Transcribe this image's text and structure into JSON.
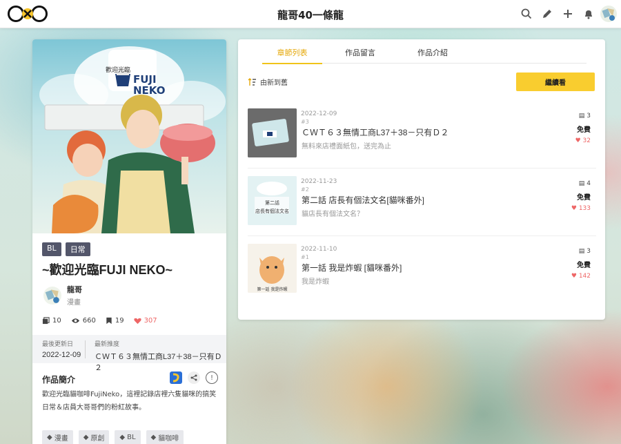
{
  "topbar": {
    "title": "龍哥40一條龍",
    "icons": [
      "search-icon",
      "pencil-icon",
      "plus-icon",
      "bell-icon",
      "user-avatar"
    ]
  },
  "work": {
    "cover_brand_top": "歡迎光臨",
    "cover_brand": "FUJI NEKO",
    "genre_tags": [
      "BL",
      "日常"
    ],
    "title": "~歡迎光臨FUJI NEKO~",
    "author_name": "龍哥",
    "author_role": "漫畫",
    "stats": {
      "episodes": "10",
      "views": "660",
      "bookmarks": "19",
      "likes": "307"
    },
    "last_update_label": "最後更新日",
    "last_update_value": "2022-12-09",
    "latest_label": "最新推度",
    "latest_value": "ＣＷＴ６３無情工商L37＋38－只有Ｄ２",
    "intro_heading": "作品簡介",
    "intro_text": "歡迎光臨貓咖啡FujiNeko，這裡記錄店裡六隻貓咪的搞笑日常＆店員大哥哥們的粉紅故事。",
    "bottom_tags": [
      "漫畫",
      "原創",
      "BL",
      "貓咖啡"
    ]
  },
  "tabs": [
    {
      "label": "章節列表",
      "active": true
    },
    {
      "label": "作品留言",
      "active": false
    },
    {
      "label": "作品介紹",
      "active": false
    }
  ],
  "sort_label": "由新到舊",
  "continue_label": "繼續看",
  "episodes": [
    {
      "date": "2022-12-09",
      "num": "#3",
      "title": "ＣＷＴ６３無情工商L37＋38－只有Ｄ２",
      "subtitle": "無料來店禮面紙包，送完為止",
      "pages": "3",
      "price": "免費",
      "likes": "32"
    },
    {
      "date": "2022-11-23",
      "num": "#2",
      "title": "第二話 店長有個法文名[貓咪番外]",
      "subtitle": "貓店長有個法文名？",
      "pages": "4",
      "price": "免費",
      "likes": "133",
      "thumb_caption_1": "第二話",
      "thumb_caption_2": "店長有個法文名"
    },
    {
      "date": "2022-11-10",
      "num": "#1",
      "title": "第一話 我是炸蝦 [貓咪番外]",
      "subtitle": "我是炸蝦",
      "pages": "3",
      "price": "免費",
      "likes": "142",
      "thumb_caption_1": "第一話 我是炸蝦"
    }
  ],
  "colors": {
    "accent": "#f9cd2f",
    "tab_active": "#e5a80a",
    "like": "#ee6666",
    "chip": "#53566a"
  }
}
